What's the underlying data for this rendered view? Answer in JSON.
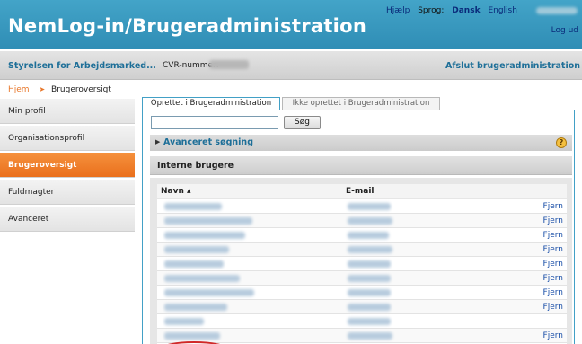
{
  "header": {
    "title": "NemLog-in/Brugeradministration",
    "help": "Hjælp",
    "language_label": "Sprog:",
    "lang_dansk": "Dansk",
    "lang_english": "English",
    "logout": "Log ud"
  },
  "orgbar": {
    "org_name": "Styrelsen for Arbejdsmarked...",
    "cvr_label": "CVR-nummer:",
    "exit": "Afslut brugeradministration"
  },
  "breadcrumb": {
    "home": "Hjem",
    "current": "Brugeroversigt"
  },
  "sidebar": {
    "items": [
      {
        "label": "Min profil",
        "active": false
      },
      {
        "label": "Organisationsprofil",
        "active": false
      },
      {
        "label": "Brugeroversigt",
        "active": true
      },
      {
        "label": "Fuldmagter",
        "active": false
      },
      {
        "label": "Avanceret",
        "active": false
      }
    ]
  },
  "tabs": {
    "tab1": "Oprettet i Brugeradministration",
    "tab2": "Ikke oprettet i Brugeradministration"
  },
  "search": {
    "value": "",
    "button": "Søg"
  },
  "advanced": {
    "label": "Avanceret søgning",
    "arrow_icon": "triangle-right",
    "help_icon": "question-mark"
  },
  "section": {
    "title": "Interne brugere"
  },
  "table": {
    "col_name": "Navn ▴",
    "col_email": "E-mail",
    "rows": [
      {
        "action": "Fjern"
      },
      {
        "action": "Fjern"
      },
      {
        "action": "Fjern"
      },
      {
        "action": "Fjern"
      },
      {
        "action": "Fjern"
      },
      {
        "action": "Fjern"
      },
      {
        "action": "Fjern"
      },
      {
        "action": "Fjern"
      },
      {
        "action": ""
      },
      {
        "action": "Fjern"
      }
    ]
  },
  "colors": {
    "header_blue": "#2f8db5",
    "link_blue": "#1e6f98",
    "active_orange": "#ea6f1c",
    "highlight_red": "#d12828"
  }
}
